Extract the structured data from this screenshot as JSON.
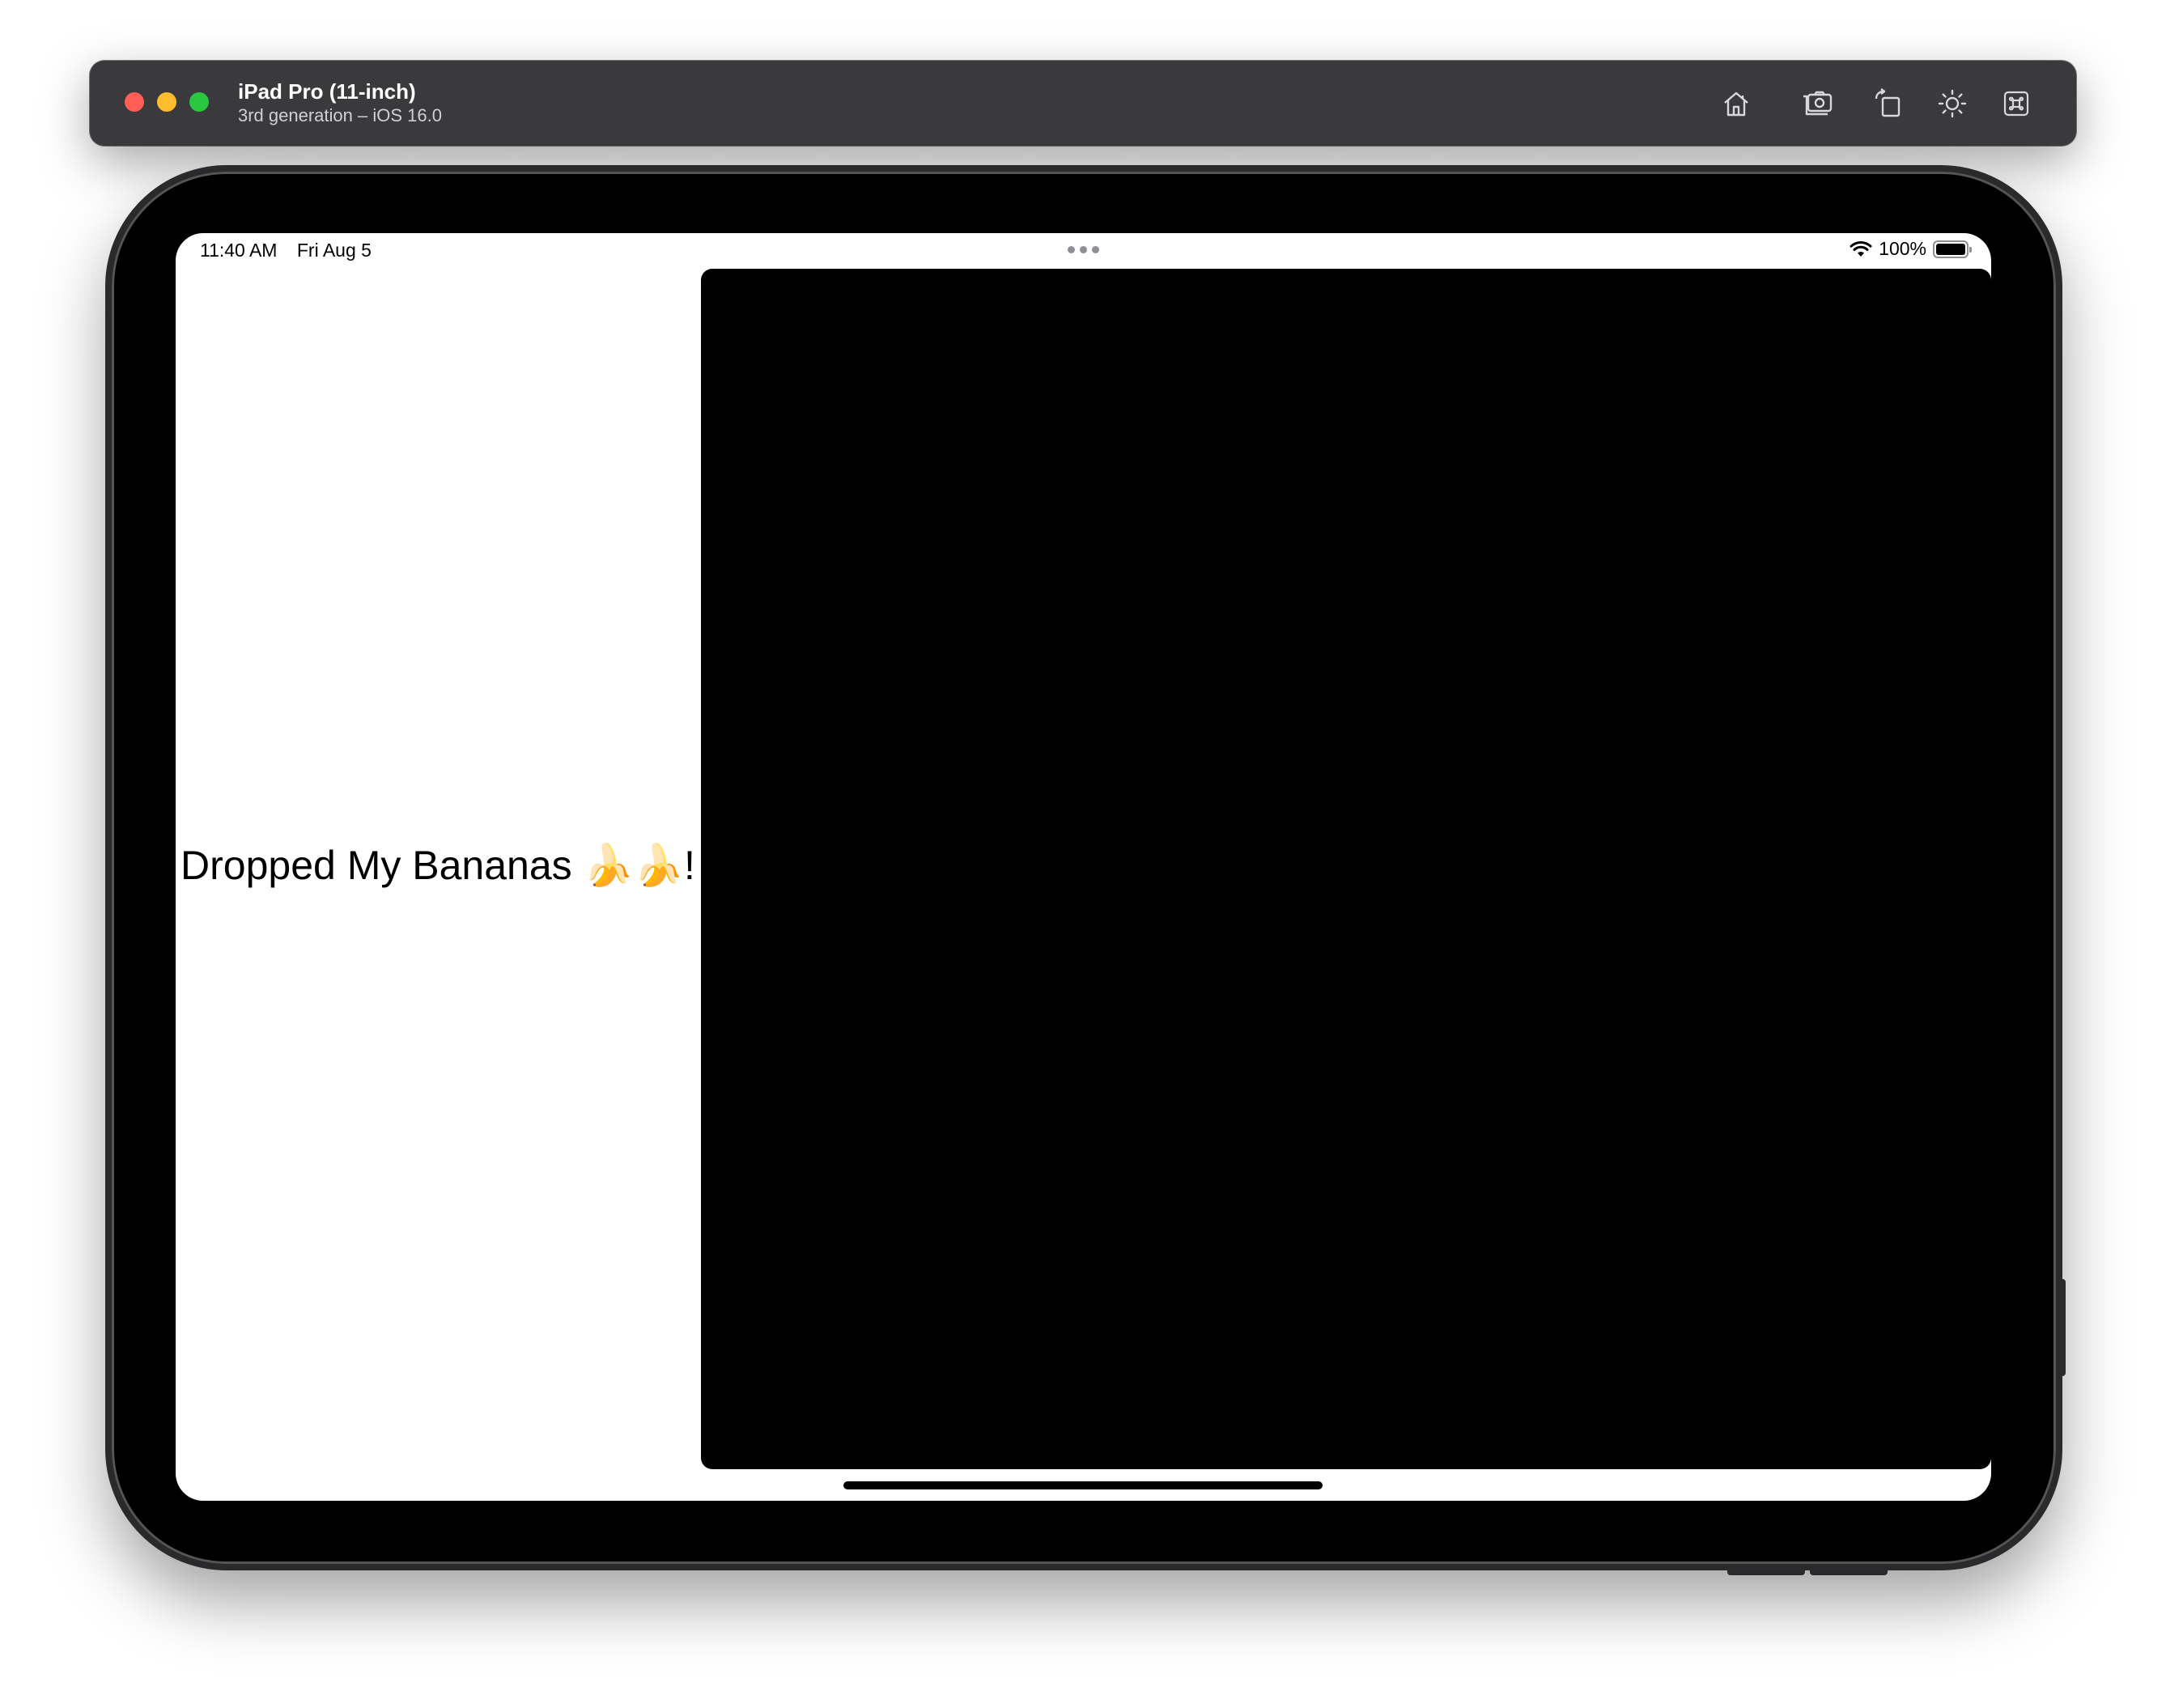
{
  "window": {
    "title": "iPad Pro (11-inch)",
    "subtitle": "3rd generation – iOS 16.0",
    "toolbar_icons": [
      "home-icon",
      "screenshot-icon",
      "rotate-icon",
      "appearance-icon",
      "keyboard-command-icon"
    ]
  },
  "status_bar": {
    "time": "11:40 AM",
    "date": "Fri Aug 5",
    "battery_percent": "100%",
    "battery_level": 1.0
  },
  "content": {
    "message": "Dropped My Bananas 🍌🍌!"
  },
  "colors": {
    "titlebar": "#3a3a3c",
    "close": "#ff5f57",
    "minimize": "#febc2e",
    "maximize": "#28c840",
    "right_pane": "#000000"
  }
}
